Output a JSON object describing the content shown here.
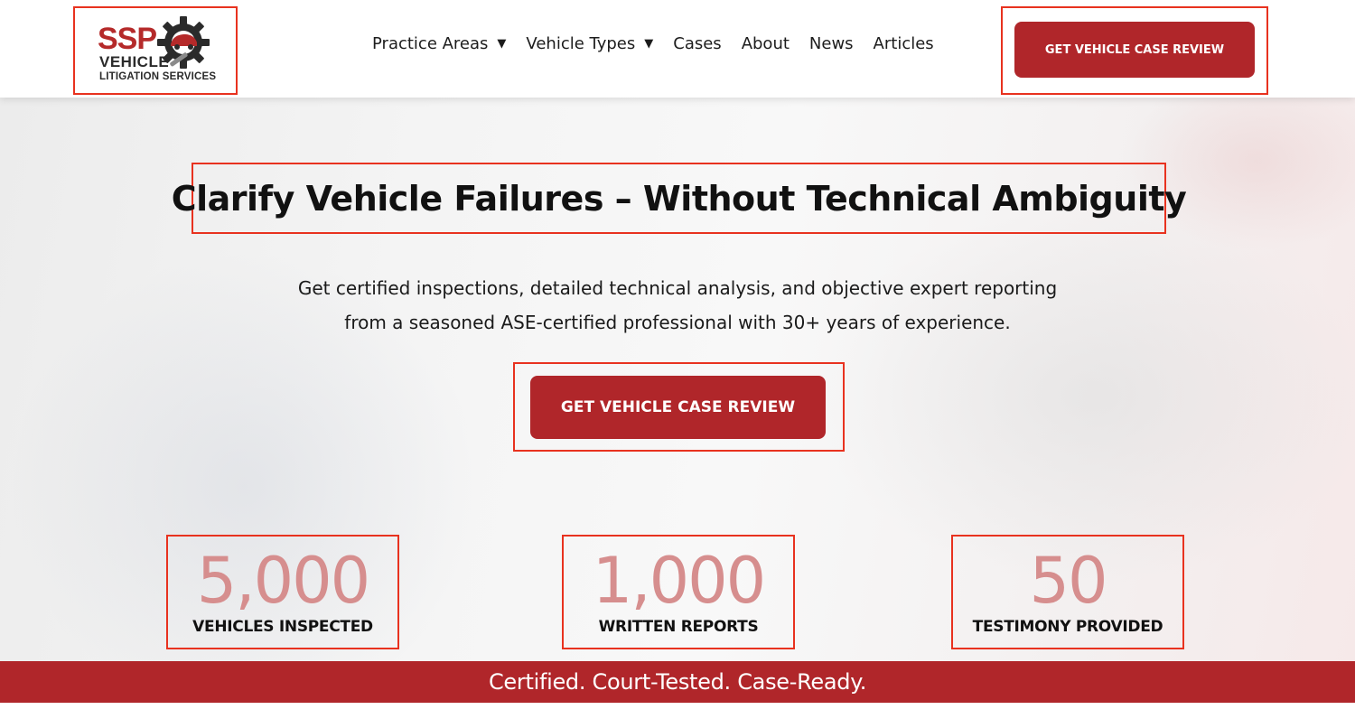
{
  "logo": {
    "brand": "SSP",
    "line1": "VEHICLE",
    "line2": "LITIGATION SERVICES",
    "icon": "gear-wrench-car-icon"
  },
  "nav": {
    "items": [
      {
        "label": "Practice Areas",
        "dropdown": true,
        "caret": "▼"
      },
      {
        "label": "Vehicle Types",
        "dropdown": true,
        "caret": "▼"
      },
      {
        "label": "Cases",
        "dropdown": false
      },
      {
        "label": "About",
        "dropdown": false
      },
      {
        "label": "News",
        "dropdown": false
      },
      {
        "label": "Articles",
        "dropdown": false
      }
    ]
  },
  "header_cta": {
    "label": "GET VEHICLE CASE REVIEW"
  },
  "hero": {
    "title": "Clarify Vehicle Failures – Without Technical Ambiguity",
    "subtitle_line1": "Get certified inspections, detailed technical analysis, and objective expert reporting",
    "subtitle_line2": "from a seasoned ASE-certified professional with 30+ years of experience.",
    "cta_label": "GET VEHICLE CASE REVIEW"
  },
  "stats": [
    {
      "value": "5,000",
      "label": "VEHICLES INSPECTED"
    },
    {
      "value": "1,000",
      "label": "WRITTEN REPORTS"
    },
    {
      "value": "50",
      "label": "TESTIMONY PROVIDED"
    }
  ],
  "banner": {
    "text": "Certified. Court-Tested. Case-Ready."
  },
  "colors": {
    "brand_red": "#b0262a",
    "highlight_outline": "#e8321f",
    "stat_number": "#d68e8e",
    "text_dark": "#111111"
  }
}
